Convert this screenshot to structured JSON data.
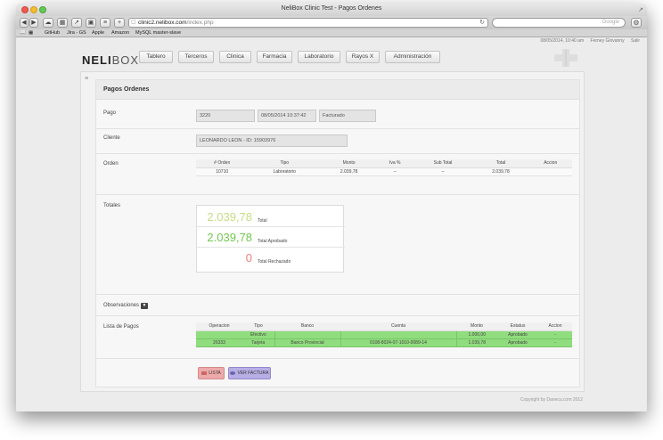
{
  "window": {
    "title": "NeliBox Clinic Test - Pagos Ordenes"
  },
  "browser": {
    "url_domain": "clinic2.nelibox.com",
    "url_path": "/index.php",
    "search_placeholder": "Google",
    "bookmarks": [
      "GitHub",
      "Jira - GS",
      "Apple",
      "Amazon",
      "MySQL master-slave"
    ]
  },
  "userbar": {
    "datetime": "08/05/2014, 10:40 am",
    "user": "Ferney Giovanny",
    "logout": "Salir"
  },
  "logo": {
    "bold": "NELI",
    "light": "BOX"
  },
  "nav": [
    "Tablero",
    "Terceros",
    "Clinica",
    "Farmacia",
    "Laboratorio",
    "Rayos X",
    "Administración"
  ],
  "panel": {
    "title": "Pagos Ordenes"
  },
  "pago": {
    "label": "Pago",
    "id": "3220",
    "fecha": "08/05/2014 10:37:42",
    "estado": "Facturado"
  },
  "cliente": {
    "label": "Cliente",
    "value": "LEONARDO LEON - ID: 15903976"
  },
  "orden": {
    "label": "Orden",
    "headers": [
      "# Orden",
      "Tipo",
      "Monto",
      "Iva %",
      "Sub Total",
      "Total",
      "Accion"
    ],
    "rows": [
      [
        "10710",
        "Laboratorio",
        "2.039,78",
        "--",
        "--",
        "2.039,78",
        ""
      ]
    ]
  },
  "totales": {
    "label": "Totales",
    "total": "2.039,78",
    "total_label": "Total",
    "aprobado": "2.039,78",
    "aprobado_label": "Total Aprobado",
    "rechazado": "0",
    "rechazado_label": "Total Rechazado"
  },
  "observaciones": {
    "label": "Observaciones"
  },
  "pagos": {
    "label": "Lista de Pagos",
    "headers": [
      "Operacion",
      "Tipo",
      "Banco",
      "Cuenta",
      "Monto",
      "Estatus",
      "Accion"
    ],
    "rows": [
      [
        "",
        "Efectivo",
        "",
        "",
        "1.000,00",
        "Aprobado",
        "-"
      ],
      [
        "26333",
        "Tarjeta",
        "Banco Provincial",
        "0108-8024-07-1010-0089-14",
        "1.039,78",
        "Aprobado",
        "-"
      ]
    ]
  },
  "buttons": {
    "lista": "LISTA",
    "ver_factura": "VER FACTURA"
  },
  "footer": "Copyright by Danecu.com 2012",
  "colors": {
    "row_green": "#90dd7d",
    "light_green": "#c4dd84",
    "green": "#71c84d",
    "red": "#f08080",
    "lista": "#eeaaaa",
    "ver": "#b8aee6"
  }
}
